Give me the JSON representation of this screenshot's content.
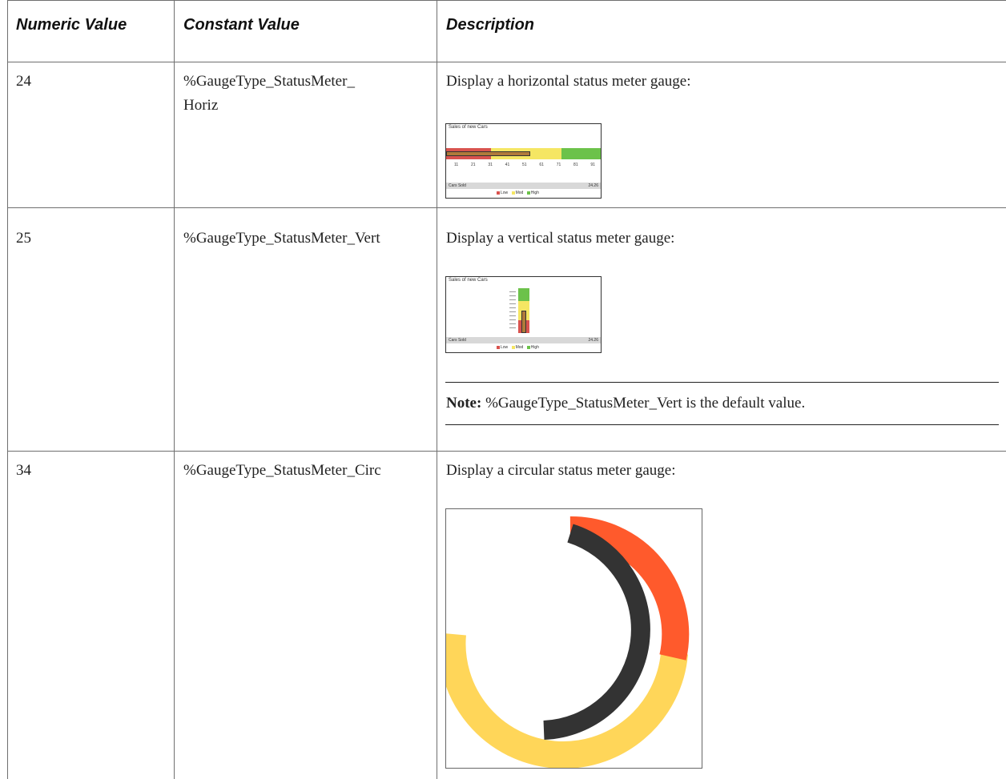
{
  "table": {
    "headers": [
      "Numeric Value",
      "Constant Value",
      "Description"
    ],
    "rows": [
      {
        "numeric": "24",
        "constant_line1": "%GaugeType_StatusMeter_",
        "constant_line2": "Horiz",
        "description": "Display a horizontal status meter gauge:"
      },
      {
        "numeric": "25",
        "constant_line1": "%GaugeType_StatusMeter_Vert",
        "description": "Display a vertical status meter gauge:",
        "note_label": "Note:",
        "note_text": " %GaugeType_StatusMeter_Vert is the default value."
      },
      {
        "numeric": "34",
        "constant_line1": "%GaugeType_StatusMeter_Circ",
        "description": "Display a circular status meter gauge:"
      }
    ]
  },
  "gauge_thumbs": {
    "horizontal": {
      "title": "Sales of new Cars",
      "ticks": [
        "11",
        "21",
        "31",
        "41",
        "51",
        "61",
        "71",
        "81",
        "91"
      ],
      "bottom_left": "Cars Sold",
      "bottom_right": "24.26",
      "legend": [
        "Low",
        "Mod",
        "High"
      ]
    },
    "vertical": {
      "title": "Sales of new Cars",
      "bottom_left": "Cars Sold",
      "bottom_right": "24.26",
      "legend": [
        "Low",
        "Mod",
        "High"
      ]
    }
  },
  "colors": {
    "low": "#d9534f",
    "mod": "#f5e663",
    "high": "#6cc24a",
    "circ_yellow": "#ffd659",
    "circ_orange": "#ff5a2c",
    "circ_dark": "#333333"
  }
}
